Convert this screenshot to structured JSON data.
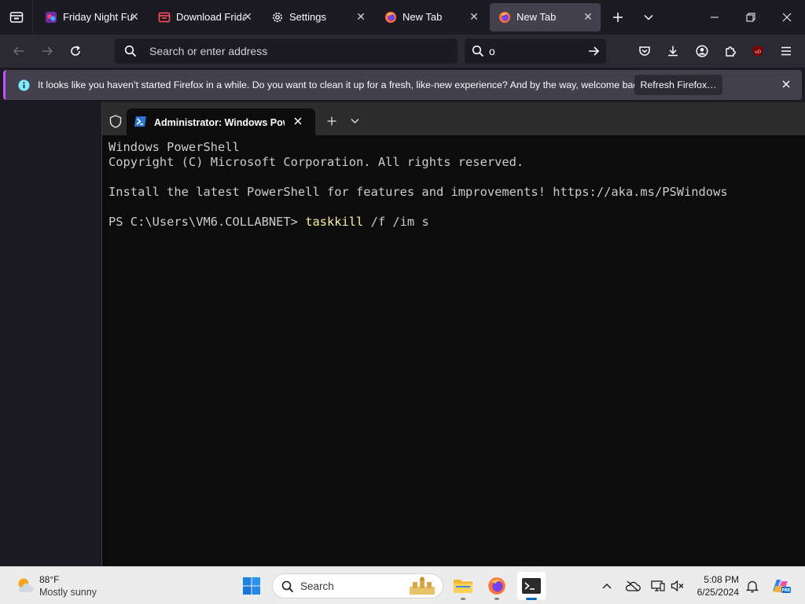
{
  "browser": {
    "tabs": [
      {
        "label": "Friday Night Fur",
        "icon": "fnf-favicon"
      },
      {
        "label": "Download Friday",
        "icon": "store-favicon"
      },
      {
        "label": "Settings",
        "icon": "gear-icon"
      },
      {
        "label": "New Tab",
        "icon": "firefox-icon"
      },
      {
        "label": "New Tab",
        "icon": "firefox-icon",
        "active": true
      }
    ],
    "address_placeholder": "Search or enter address",
    "search_value": "o",
    "notification": {
      "message": "It looks like you haven’t started Firefox in a while. Do you want to clean it up for a fresh, like-new experience? And by the way, welcome back!",
      "button_label": "Refresh Firefox…"
    },
    "accent_color": "#c94fff"
  },
  "terminal": {
    "tab_title": "Administrator: Windows PowerShell",
    "lines": [
      "Windows PowerShell",
      "Copyright (C) Microsoft Corporation. All rights reserved.",
      "",
      "Install the latest PowerShell for features and improvements! https://aka.ms/PSWindows",
      ""
    ],
    "prompt": "PS C:\\Users\\VM6.COLLABNET> ",
    "command": "taskkill",
    "command_args": " /f /im s",
    "command_color": "#f9f1a5"
  },
  "taskbar": {
    "weather": {
      "temp": "88°F",
      "desc": "Mostly sunny"
    },
    "search_placeholder": "Search",
    "apps": [
      "file-explorer-icon",
      "firefox-icon",
      "terminal-icon"
    ],
    "clock": {
      "time": "5:08 PM",
      "date": "6/25/2024"
    }
  }
}
